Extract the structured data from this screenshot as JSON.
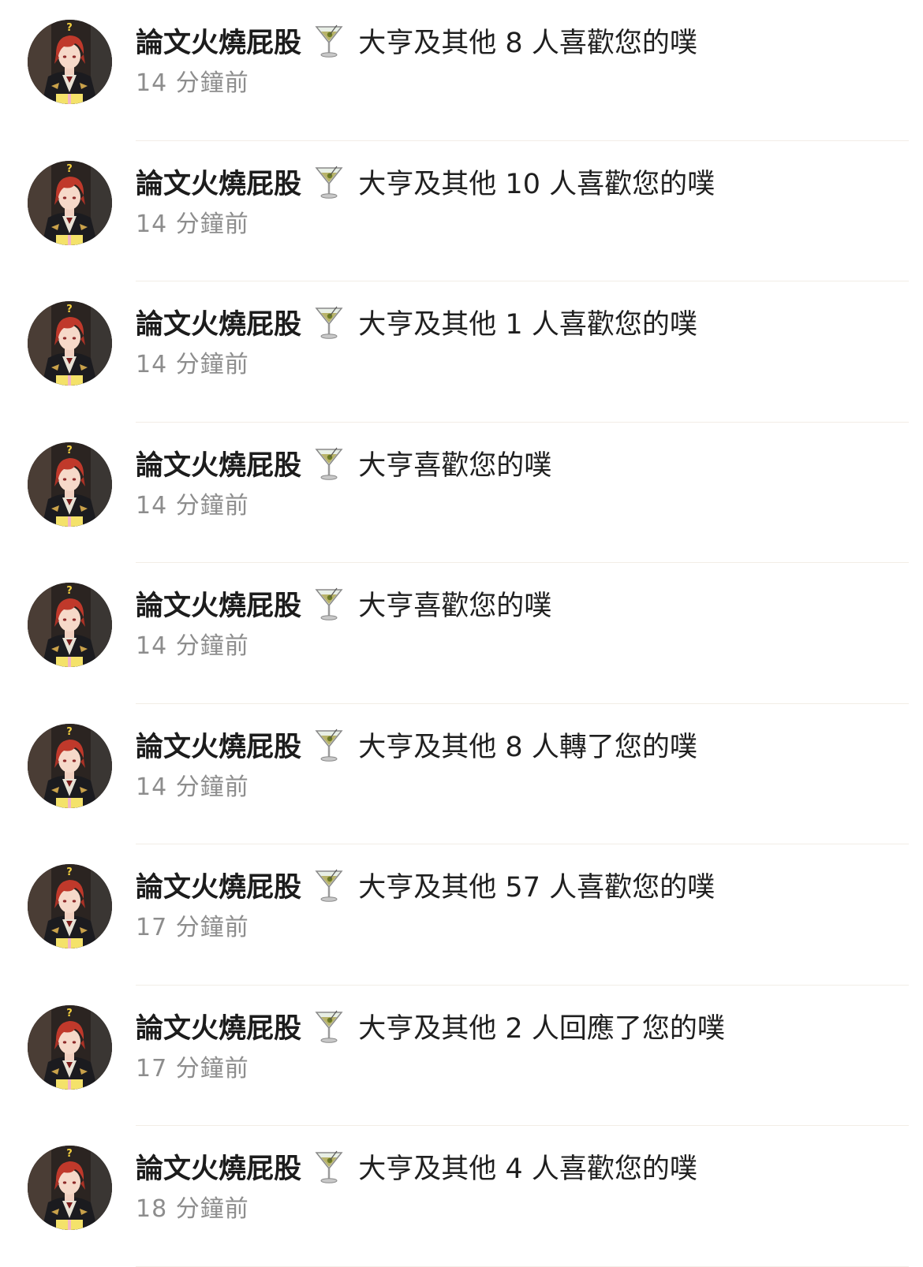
{
  "notifications": [
    {
      "nickname": "論文火燒屁股",
      "emoji_icon": "cocktail-glass-icon",
      "action": "大亨及其他 8 人喜歡您的噗",
      "time": "14 分鐘前"
    },
    {
      "nickname": "論文火燒屁股",
      "emoji_icon": "cocktail-glass-icon",
      "action": "大亨及其他 10 人喜歡您的噗",
      "time": "14 分鐘前"
    },
    {
      "nickname": "論文火燒屁股",
      "emoji_icon": "cocktail-glass-icon",
      "action": "大亨及其他 1 人喜歡您的噗",
      "time": "14 分鐘前"
    },
    {
      "nickname": "論文火燒屁股",
      "emoji_icon": "cocktail-glass-icon",
      "action": "大亨喜歡您的噗",
      "time": "14 分鐘前"
    },
    {
      "nickname": "論文火燒屁股",
      "emoji_icon": "cocktail-glass-icon",
      "action": "大亨喜歡您的噗",
      "time": "14 分鐘前"
    },
    {
      "nickname": "論文火燒屁股",
      "emoji_icon": "cocktail-glass-icon",
      "action": "大亨及其他 8 人轉了您的噗",
      "time": "14 分鐘前"
    },
    {
      "nickname": "論文火燒屁股",
      "emoji_icon": "cocktail-glass-icon",
      "action": "大亨及其他 57 人喜歡您的噗",
      "time": "17 分鐘前"
    },
    {
      "nickname": "論文火燒屁股",
      "emoji_icon": "cocktail-glass-icon",
      "action": "大亨及其他 2 人回應了您的噗",
      "time": "17 分鐘前"
    },
    {
      "nickname": "論文火燒屁股",
      "emoji_icon": "cocktail-glass-icon",
      "action": "大亨及其他 4 人喜歡您的噗",
      "time": "18 分鐘前"
    }
  ],
  "colors": {
    "background": "#ffffff",
    "text": "#1f1f1f",
    "time": "#8d8d8d",
    "divider": "#f2ede6",
    "avatar_hair": "#c0392b",
    "avatar_badge": "#f4d03f"
  }
}
